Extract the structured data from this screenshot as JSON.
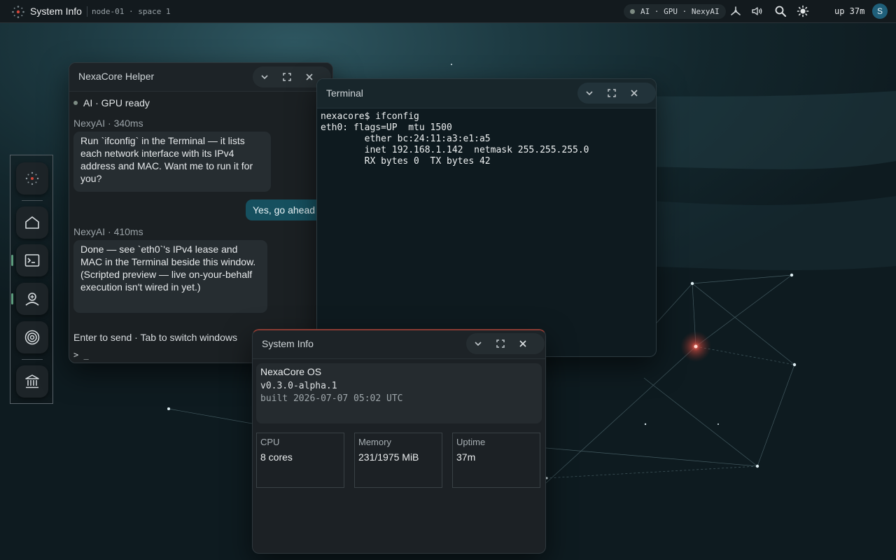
{
  "topbar": {
    "app_title": "System Info",
    "workspace": "node-01 · space 1",
    "status": "AI · GPU · NexyAI",
    "uptime": "up 37m",
    "avatar_initial": "S",
    "icons": [
      "network-icon",
      "volume-icon",
      "search-icon",
      "brightness-icon"
    ]
  },
  "dock": {
    "items": [
      {
        "name": "launcher",
        "icon": "constellation-icon"
      },
      {
        "name": "home",
        "icon": "home-icon"
      },
      {
        "name": "terminal",
        "icon": "terminal-icon"
      },
      {
        "name": "helper",
        "icon": "ai-helper-icon"
      },
      {
        "name": "target",
        "icon": "target-icon"
      },
      {
        "name": "system-info",
        "icon": "institution-icon"
      }
    ]
  },
  "helper": {
    "title": "NexaCore Helper",
    "status": "AI · GPU ready",
    "messages": [
      {
        "from": "assistant",
        "meta": "NexyAI · 340ms",
        "text": "Run `ifconfig` in the Terminal — it lists each network interface with its IPv4 address and MAC. Want me to run it for you?"
      },
      {
        "from": "user",
        "text": "Yes, go ahead"
      },
      {
        "from": "assistant",
        "meta": "NexyAI · 410ms",
        "text": "Done — see `eth0`'s IPv4 lease and MAC in the Terminal beside this window. (Scripted preview — live on-your-behalf execution isn't wired in yet.)"
      }
    ],
    "hint": "Enter to send · Tab to switch windows",
    "prompt": "> _"
  },
  "terminal": {
    "title": "Terminal",
    "lines": [
      "nexacore$ ifconfig",
      "eth0: flags=UP  mtu 1500",
      "        ether bc:24:11:a3:e1:a5",
      "        inet 192.168.1.142  netmask 255.255.255.0",
      "        RX bytes 0  TX bytes 42"
    ]
  },
  "sysinfo": {
    "title": "System Info",
    "os_name": "NexaCore OS",
    "version": "v0.3.0-alpha.1",
    "built": "built 2026-07-07 05:02 UTC",
    "stats": [
      {
        "label": "CPU",
        "value": "8 cores"
      },
      {
        "label": "Memory",
        "value": "231/1975 MiB"
      },
      {
        "label": "Uptime",
        "value": "37m"
      }
    ]
  },
  "colors": {
    "accent_teal": "#16505f",
    "status_dot": "#7c8a82",
    "focus_bar": "#8a3b33",
    "dock_indicator": "#5d9c7d"
  }
}
